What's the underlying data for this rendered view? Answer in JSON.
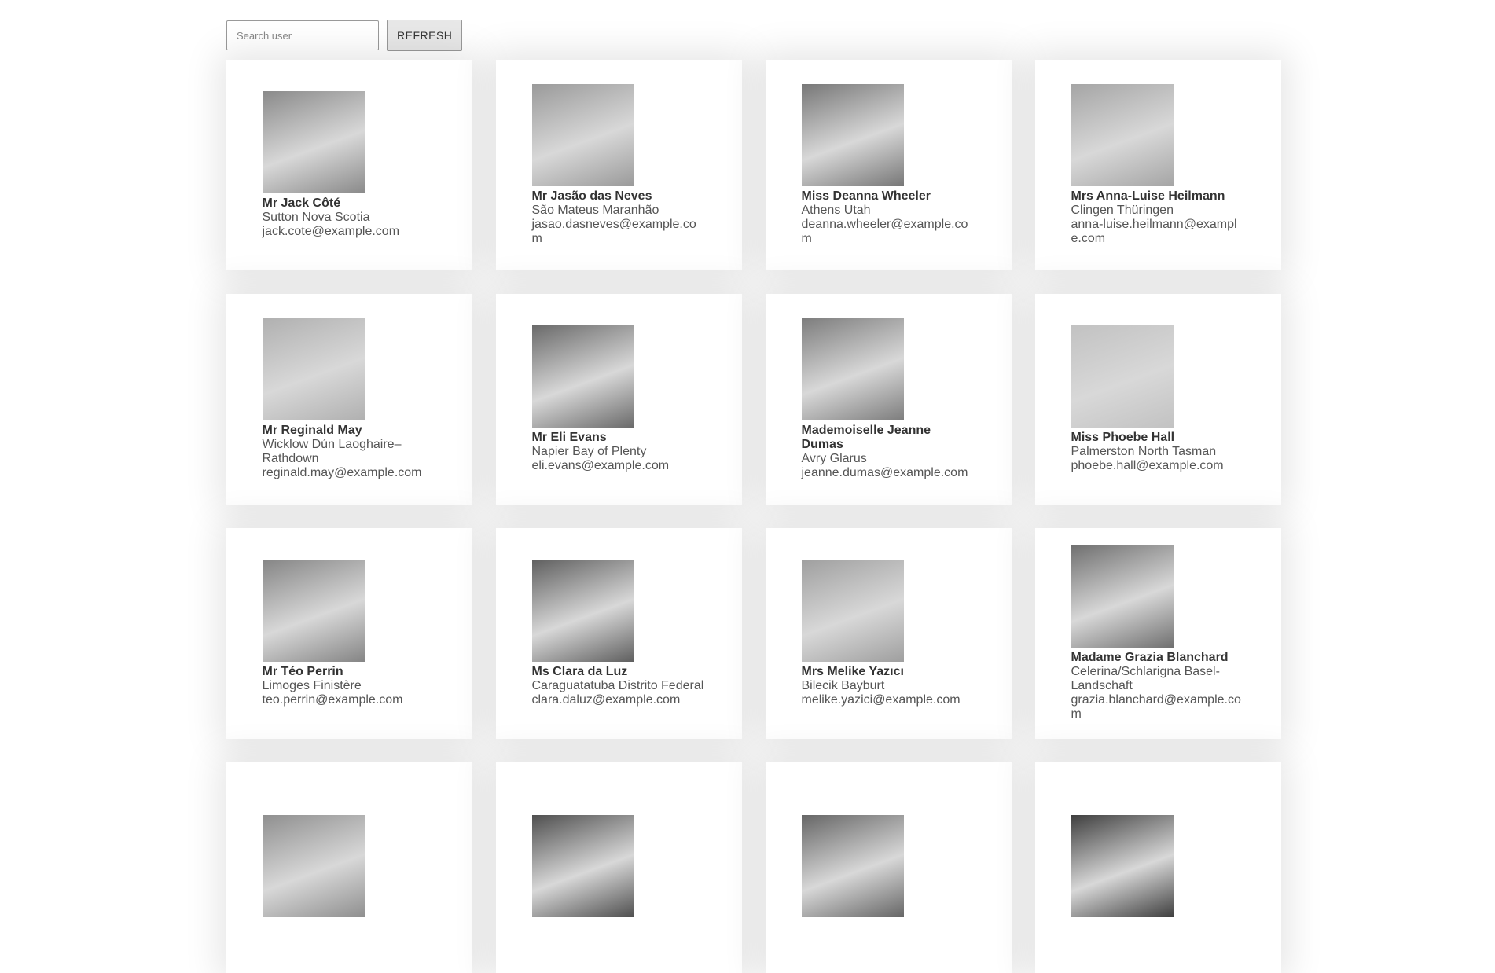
{
  "search": {
    "placeholder": "Search user",
    "value": ""
  },
  "refresh_label": "REFRESH",
  "users": [
    {
      "name": "Mr Jack Côté",
      "location": "Sutton Nova Scotia",
      "email": "jack.cote@example.com",
      "tone": "#8a8a8a"
    },
    {
      "name": "Mr Jasão das Neves",
      "location": "São Mateus Maranhão",
      "email": "jasao.dasneves@example.com",
      "tone": "#9a9a9a"
    },
    {
      "name": "Miss Deanna Wheeler",
      "location": "Athens Utah",
      "email": "deanna.wheeler@example.com",
      "tone": "#777777"
    },
    {
      "name": "Mrs Anna-Luise Heilmann",
      "location": "Clingen Thüringen",
      "email": "anna-luise.heilmann@example.com",
      "tone": "#a5a5a5"
    },
    {
      "name": "Mr Reginald May",
      "location": "Wicklow Dún Laoghaire–Rathdown",
      "email": "reginald.may@example.com",
      "tone": "#b0b0b0"
    },
    {
      "name": "Mr Eli Evans",
      "location": "Napier Bay of Plenty",
      "email": "eli.evans@example.com",
      "tone": "#6a6a6a"
    },
    {
      "name": "Mademoiselle Jeanne Dumas",
      "location": "Avry Glarus",
      "email": "jeanne.dumas@example.com",
      "tone": "#7d7d7d"
    },
    {
      "name": "Miss Phoebe Hall",
      "location": "Palmerston North Tasman",
      "email": "phoebe.hall@example.com",
      "tone": "#c2c2c2"
    },
    {
      "name": "Mr Téo Perrin",
      "location": "Limoges Finistère",
      "email": "teo.perrin@example.com",
      "tone": "#858585"
    },
    {
      "name": "Ms Clara da Luz",
      "location": "Caraguatatuba Distrito Federal",
      "email": "clara.daluz@example.com",
      "tone": "#5f5f5f"
    },
    {
      "name": "Mrs Melike Yazıcı",
      "location": "Bilecik Bayburt",
      "email": "melike.yazici@example.com",
      "tone": "#9f9f9f"
    },
    {
      "name": "Madame Grazia Blanchard",
      "location": "Celerina/Schlarigna Basel-Landschaft",
      "email": "grazia.blanchard@example.com",
      "tone": "#707070"
    },
    {
      "name": "",
      "location": "",
      "email": "",
      "tone": "#8f8f8f"
    },
    {
      "name": "",
      "location": "",
      "email": "",
      "tone": "#4f4f4f"
    },
    {
      "name": "",
      "location": "",
      "email": "",
      "tone": "#666666"
    },
    {
      "name": "",
      "location": "",
      "email": "",
      "tone": "#3f3f3f"
    }
  ]
}
